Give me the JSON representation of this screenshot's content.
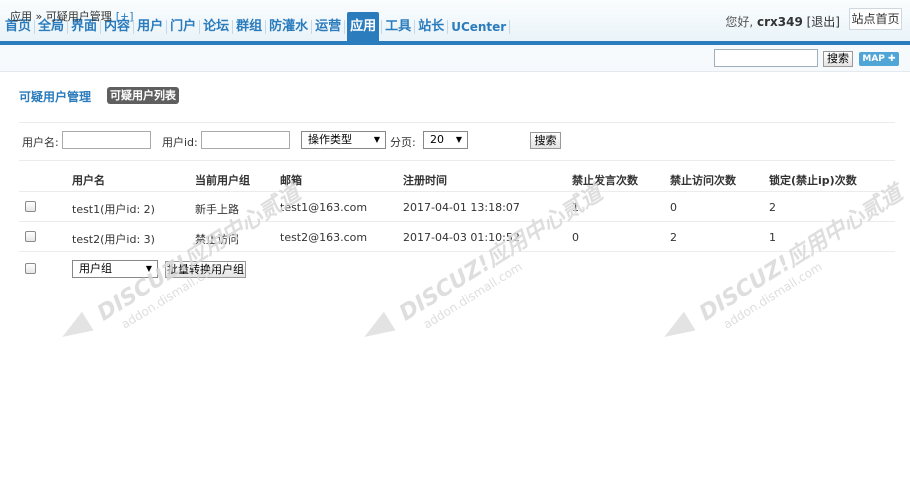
{
  "nav": {
    "items": [
      "首页",
      "全局",
      "界面",
      "内容",
      "用户",
      "门户",
      "论坛",
      "群组",
      "防灌水",
      "运营",
      "应用",
      "工具",
      "站长",
      "UCenter"
    ],
    "active": "应用"
  },
  "user": {
    "greeting": "您好,",
    "name": "crx349",
    "logout": "[退出]",
    "home": "站点首页"
  },
  "breadcrumb": {
    "text": "应用 » 可疑用户管理",
    "plus": "[+]"
  },
  "topsearch": {
    "button": "搜索",
    "map": "MAP ✚"
  },
  "page": {
    "title": "可疑用户管理",
    "tab": "可疑用户列表"
  },
  "filter": {
    "username_label": "用户名:",
    "uid_label": "用户id:",
    "op_type": "操作类型",
    "page_label": "分页:",
    "page_size": "20",
    "search": "搜索"
  },
  "table": {
    "headers": [
      "用户名",
      "当前用户组",
      "邮箱",
      "注册时间",
      "禁止发言次数",
      "禁止访问次数",
      "锁定(禁止ip)次数"
    ],
    "rows": [
      [
        "test1(用户id: 2)",
        "新手上路",
        "test1@163.com",
        "2017-04-01 13:18:07",
        "1",
        "0",
        "2"
      ],
      [
        "test2(用户id: 3)",
        "禁止访问",
        "test2@163.com",
        "2017-04-03 01:10:52",
        "0",
        "2",
        "1"
      ]
    ]
  },
  "batch": {
    "group_select": "用户组",
    "convert_button": "批量转换用户组"
  },
  "watermark": {
    "brand": "DISCUZ!应用中心",
    "sub": "addon.dismall.com",
    "extra": "贰道"
  },
  "colors": {
    "accent": "#2b7cbd",
    "tab_bg": "#5f5f5f",
    "map_btn": "#4ea5d6"
  }
}
